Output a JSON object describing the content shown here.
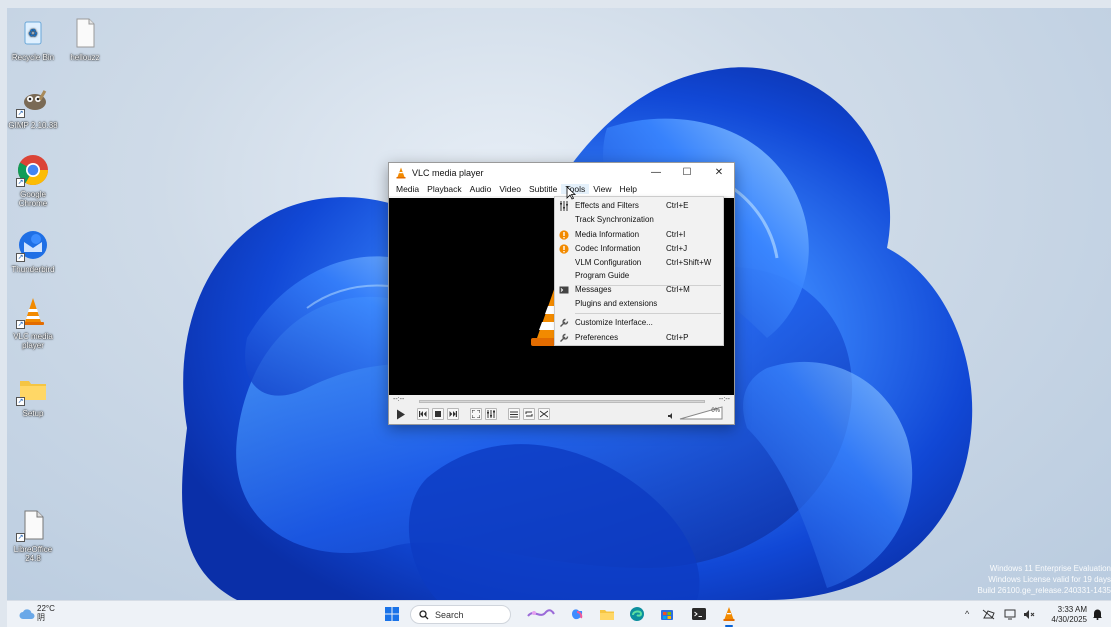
{
  "desktop": {
    "icons": [
      {
        "label": "Recycle Bin"
      },
      {
        "label": "hellouzz"
      },
      {
        "label": "GIMP 2.10.38"
      },
      {
        "label": "Google Chrome"
      },
      {
        "label": "Thunderbird"
      },
      {
        "label": "VLC media player"
      },
      {
        "label": "Setup"
      },
      {
        "label": "LibreOffice 24.8"
      }
    ],
    "watermark": {
      "line1": "Windows 11 Enterprise Evaluation",
      "line2": "Windows License valid for 19 days",
      "line3": "Build 26100.ge_release.240331-1435"
    }
  },
  "vlc": {
    "title": "VLC media player",
    "window_controls": {
      "minimize": "—",
      "maximize": "☐",
      "close": "✕"
    },
    "menubar": [
      "Media",
      "Playback",
      "Audio",
      "Video",
      "Subtitle",
      "Tools",
      "View",
      "Help"
    ],
    "active_menu": "Tools",
    "time_elapsed": "--:--",
    "time_total": "--:--",
    "volume": "0%"
  },
  "tools_menu": {
    "items": [
      {
        "label": "Effects and Filters",
        "shortcut": "Ctrl+E",
        "icon": "equalizer-icon"
      },
      {
        "label": "Track Synchronization",
        "shortcut": "",
        "icon": ""
      },
      {
        "label": "Media Information",
        "shortcut": "Ctrl+I",
        "icon": "info-icon"
      },
      {
        "label": "Codec Information",
        "shortcut": "Ctrl+J",
        "icon": "info-icon"
      },
      {
        "label": "VLM Configuration",
        "shortcut": "Ctrl+Shift+W",
        "icon": ""
      },
      {
        "label": "Program Guide",
        "shortcut": "",
        "icon": ""
      },
      {
        "label": "Messages",
        "shortcut": "Ctrl+M",
        "icon": "terminal-icon"
      },
      {
        "label": "Plugins and extensions",
        "shortcut": "",
        "icon": ""
      },
      {
        "label": "Customize Interface...",
        "shortcut": "",
        "icon": "wrench-icon"
      },
      {
        "label": "Preferences",
        "shortcut": "Ctrl+P",
        "icon": "wrench-icon"
      }
    ]
  },
  "taskbar": {
    "weather_temp": "22°C",
    "weather_cond": "阴",
    "search_placeholder": "Search",
    "time": "3:33 AM",
    "date": "4/30/2025"
  },
  "colors": {
    "vlc_orange": "#f28a00",
    "wallpaper_blue": "#1f5fe0",
    "menu_bg": "#f2f2f2"
  }
}
